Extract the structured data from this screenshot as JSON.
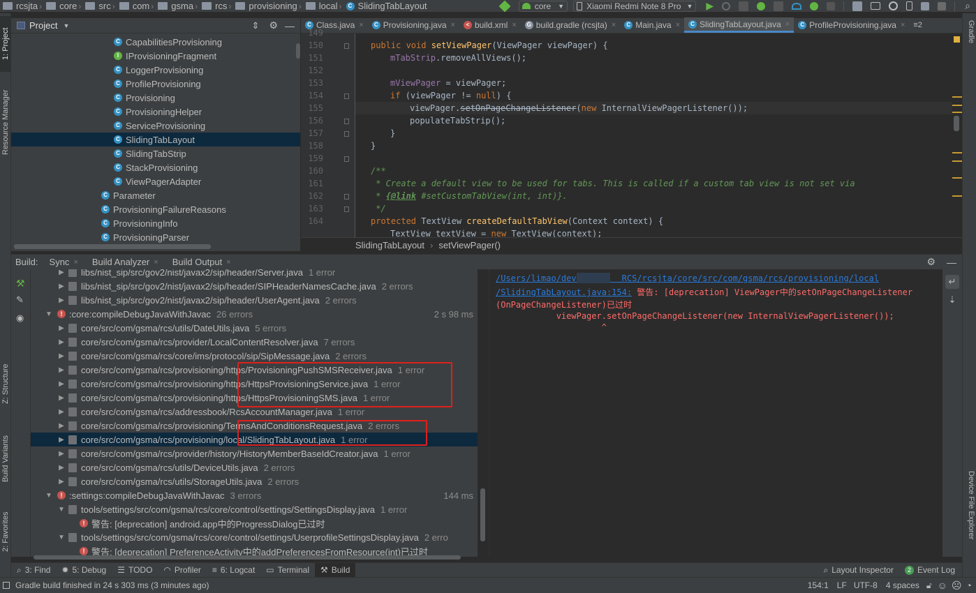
{
  "breadcrumbs": [
    "rcsjta",
    "core",
    "src",
    "com",
    "gsma",
    "rcs",
    "provisioning",
    "local",
    "SlidingTabLayout"
  ],
  "run_config": "core",
  "device": "Xiaomi Redmi Note 8 Pro",
  "left_stripe": {
    "project": "1: Project",
    "resource_manager": "Resource Manager",
    "structure": "Z: Structure",
    "build_variants": "Build Variants",
    "favorites": "2: Favorites"
  },
  "right_stripe": {
    "gradle": "Gradle",
    "device_file_explorer": "Device File Explorer"
  },
  "project_panel": {
    "title": "Project",
    "items": [
      {
        "name": "CapabilitiesProvisioning",
        "icon": "c",
        "indent": 1
      },
      {
        "name": "IProvisioningFragment",
        "icon": "i",
        "indent": 1
      },
      {
        "name": "LoggerProvisioning",
        "icon": "c",
        "indent": 1
      },
      {
        "name": "ProfileProvisioning",
        "icon": "c",
        "indent": 1
      },
      {
        "name": "Provisioning",
        "icon": "c",
        "indent": 1
      },
      {
        "name": "ProvisioningHelper",
        "icon": "c",
        "indent": 1
      },
      {
        "name": "ServiceProvisioning",
        "icon": "c",
        "indent": 1
      },
      {
        "name": "SlidingTabLayout",
        "icon": "c",
        "indent": 1,
        "selected": true
      },
      {
        "name": "SlidingTabStrip",
        "icon": "c",
        "indent": 1
      },
      {
        "name": "StackProvisioning",
        "icon": "c",
        "indent": 1
      },
      {
        "name": "ViewPagerAdapter",
        "icon": "c",
        "indent": 1
      },
      {
        "name": "Parameter",
        "icon": "c",
        "indent": 0
      },
      {
        "name": "ProvisioningFailureReasons",
        "icon": "c",
        "indent": 0
      },
      {
        "name": "ProvisioningInfo",
        "icon": "c",
        "indent": 0
      },
      {
        "name": "ProvisioningParser",
        "icon": "c",
        "indent": 0
      }
    ]
  },
  "editor_tabs": [
    {
      "label": "Class.java",
      "icon": "c"
    },
    {
      "label": "Provisioning.java",
      "icon": "c"
    },
    {
      "label": "build.xml",
      "icon": "x"
    },
    {
      "label": "build.gradle (rcsjta)",
      "icon": "g"
    },
    {
      "label": "Main.java",
      "icon": "c"
    },
    {
      "label": "SlidingTabLayout.java",
      "icon": "c",
      "active": true
    },
    {
      "label": "ProfileProvisioning.java",
      "icon": "c"
    }
  ],
  "tabs_overflow": "≡2",
  "code": {
    "line_numbers": [
      "149",
      "150",
      "151",
      "152",
      "153",
      "154",
      "155",
      "156",
      "157",
      "158",
      "159",
      "160",
      "161",
      "162",
      "163",
      "164"
    ],
    "l149": {
      "kw1": "public ",
      "kw2": "void ",
      "fn": "setViewPager",
      "rest": "(ViewPager viewPager) {"
    },
    "l150": {
      "fld": "mTabStrip",
      "rest": ".removeAllViews();"
    },
    "l152": {
      "fld": "mViewPager",
      "rest": " = viewPager;"
    },
    "l153": {
      "kw": "if ",
      "a": "(viewPager != ",
      "kw2": "null",
      "b": ") {"
    },
    "l154": {
      "a": "viewPager.",
      "dep": "setOnPageChangeListener",
      "b": "(",
      "kw": "new ",
      "c": "InternalViewPagerListener());"
    },
    "l155": {
      "a": "populateTabStrip();"
    },
    "l156": {
      "a": "}"
    },
    "l157": {
      "a": "}"
    },
    "l159": {
      "cm": "/**"
    },
    "l160": {
      "cm": " * Create a default view to be used for tabs. This is called if a custom tab view is not set via"
    },
    "l161": {
      "a": " * ",
      "tag": "{@link",
      "b": " #setCustomTabView(int, int)}."
    },
    "l162": {
      "cm": " */"
    },
    "l163": {
      "kw": "protected ",
      "a": "TextView ",
      "fn": "createDefaultTabView",
      "b": "(Context context) {"
    },
    "l164": {
      "a": "TextView textView = ",
      "kw": "new ",
      "b": "TextView(context);"
    }
  },
  "editor_breadcrumb": [
    "SlidingTabLayout",
    "setViewPager()"
  ],
  "build_panel": {
    "label": "Build:",
    "tabs": [
      "Sync",
      "Build Analyzer",
      "Build Output"
    ],
    "rows": [
      {
        "indent": 1,
        "arrow": "▶",
        "type": "file",
        "text": "libs/nist_sip/src/gov2/nist/javax2/sip/header/Server.java",
        "count": "1 error"
      },
      {
        "indent": 1,
        "arrow": "▶",
        "type": "file",
        "text": "libs/nist_sip/src/gov2/nist/javax2/sip/header/SIPHeaderNamesCache.java",
        "count": "2 errors"
      },
      {
        "indent": 1,
        "arrow": "▶",
        "type": "file",
        "text": "libs/nist_sip/src/gov2/nist/javax2/sip/header/UserAgent.java",
        "count": "2 errors"
      },
      {
        "indent": 0,
        "arrow": "▼",
        "type": "task",
        "text": ":core:compileDebugJavaWithJavac",
        "count": "26 errors",
        "time": "2 s 98 ms"
      },
      {
        "indent": 1,
        "arrow": "▶",
        "type": "file",
        "text": "core/src/com/gsma/rcs/utils/DateUtils.java",
        "count": "5 errors"
      },
      {
        "indent": 1,
        "arrow": "▶",
        "type": "file",
        "text": "core/src/com/gsma/rcs/provider/LocalContentResolver.java",
        "count": "7 errors"
      },
      {
        "indent": 1,
        "arrow": "▶",
        "type": "file",
        "text": "core/src/com/gsma/rcs/core/ims/protocol/sip/SipMessage.java",
        "count": "2 errors"
      },
      {
        "indent": 1,
        "arrow": "▶",
        "type": "file",
        "text": "core/src/com/gsma/rcs/provisioning/https/ProvisioningPushSMSReceiver.java",
        "count": "1 error"
      },
      {
        "indent": 1,
        "arrow": "▶",
        "type": "file",
        "text": "core/src/com/gsma/rcs/provisioning/https/HttpsProvisioningService.java",
        "count": "1 error"
      },
      {
        "indent": 1,
        "arrow": "▶",
        "type": "file",
        "text": "core/src/com/gsma/rcs/provisioning/https/HttpsProvisioningSMS.java",
        "count": "1 error"
      },
      {
        "indent": 1,
        "arrow": "▶",
        "type": "file",
        "text": "core/src/com/gsma/rcs/addressbook/RcsAccountManager.java",
        "count": "1 error"
      },
      {
        "indent": 1,
        "arrow": "▶",
        "type": "file",
        "text": "core/src/com/gsma/rcs/provisioning/TermsAndConditionsRequest.java",
        "count": "2 errors"
      },
      {
        "indent": 1,
        "arrow": "▶",
        "type": "file",
        "text": "core/src/com/gsma/rcs/provisioning/local/SlidingTabLayout.java",
        "count": "1 error",
        "selected": true
      },
      {
        "indent": 1,
        "arrow": "▶",
        "type": "file",
        "text": "core/src/com/gsma/rcs/provider/history/HistoryMemberBaseIdCreator.java",
        "count": "1 error"
      },
      {
        "indent": 1,
        "arrow": "▶",
        "type": "file",
        "text": "core/src/com/gsma/rcs/utils/DeviceUtils.java",
        "count": "2 errors"
      },
      {
        "indent": 1,
        "arrow": "▶",
        "type": "file",
        "text": "core/src/com/gsma/rcs/utils/StorageUtils.java",
        "count": "2 errors"
      },
      {
        "indent": 0,
        "arrow": "▼",
        "type": "task",
        "text": ":settings:compileDebugJavaWithJavac",
        "count": "3 errors",
        "time": "144 ms"
      },
      {
        "indent": 1,
        "arrow": "▼",
        "type": "file",
        "text": "tools/settings/src/com/gsma/rcs/core/control/settings/SettingsDisplay.java",
        "count": "1 error"
      },
      {
        "indent": 2,
        "arrow": "",
        "type": "msg",
        "text": "警告: [deprecation] android.app中的ProgressDialog已过时",
        "count": ""
      },
      {
        "indent": 1,
        "arrow": "▼",
        "type": "file",
        "text": "tools/settings/src/com/gsma/rcs/core/control/settings/UserprofileSettingsDisplay.java",
        "count": "2 erro"
      },
      {
        "indent": 2,
        "arrow": "",
        "type": "msg",
        "text": "警告: [deprecation] PreferenceActivity中的addPreferencesFromResource(int)已过时",
        "count": ""
      }
    ]
  },
  "build_output": {
    "line1": "/Users/limao/dev/        RCS/rcsjta/core/src/com/gsma/rcs/provisioning/local",
    "line2_link": "/SlidingTabLayout.java:154:",
    "line2_rest": " 警告: [deprecation] ViewPager中的setOnPageChangeListener",
    "line3": "(OnPageChangeListener)已过时",
    "line4": "            viewPager.setOnPageChangeListener(new InternalViewPagerListener());",
    "line5": "                     ^"
  },
  "tool_windows": [
    {
      "label": "3: Find",
      "icon": "search-icon"
    },
    {
      "label": "5: Debug",
      "icon": "bug-icon"
    },
    {
      "label": "TODO",
      "icon": "list-icon"
    },
    {
      "label": "Profiler",
      "icon": "profiler-icon"
    },
    {
      "label": "6: Logcat",
      "icon": "logcat-icon"
    },
    {
      "label": "Terminal",
      "icon": "terminal-icon"
    },
    {
      "label": "Build",
      "icon": "hammer-icon",
      "active": true
    }
  ],
  "right_tool_windows": [
    {
      "label": "Layout Inspector"
    },
    {
      "label": "Event Log",
      "badge": "2"
    }
  ],
  "status": {
    "message": "Gradle build finished in 24 s 303 ms (3 minutes ago)",
    "position": "154:1",
    "line_sep": "LF",
    "encoding": "UTF-8",
    "indent": "4 spaces"
  },
  "colors": {
    "accent": "#4a88c7",
    "error": "#e0201c",
    "panel": "#3c3f41",
    "editor": "#2b2b2b"
  }
}
